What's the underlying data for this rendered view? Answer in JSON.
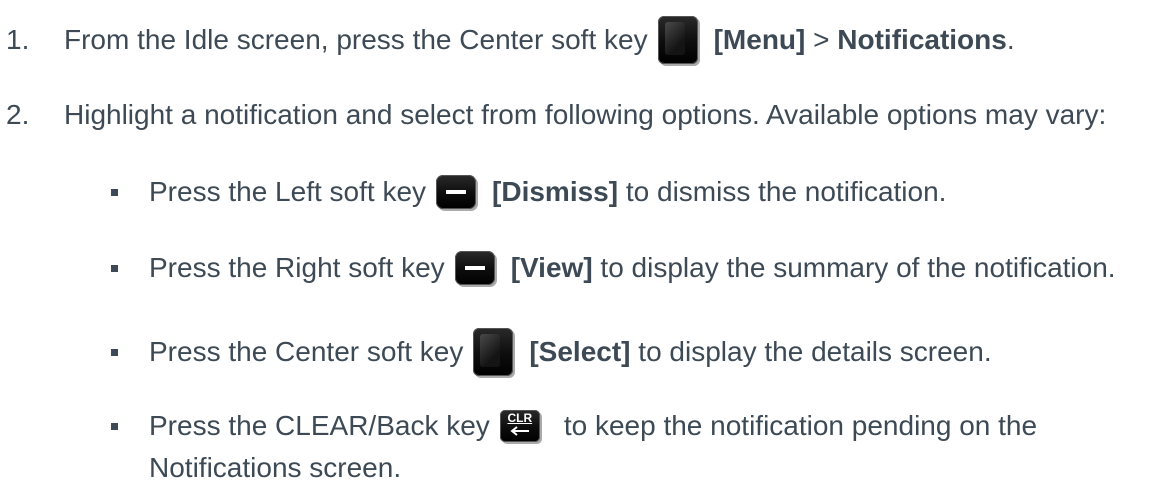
{
  "step1": {
    "number": "1.",
    "text_before": "From the Idle screen, press the Center soft key",
    "menu_label": "[Menu]",
    "separator": ">",
    "notifications_label": "Notifications",
    "period": "."
  },
  "step2": {
    "number": "2.",
    "text": "Highlight a notification and select from following options. Available options may vary:"
  },
  "options": {
    "dismiss": {
      "text_before": "Press the Left soft key",
      "label": "[Dismiss]",
      "text_after": "to dismiss the notification."
    },
    "view": {
      "text_before": "Press the Right soft key",
      "label": "[View]",
      "text_after": "to display the summary of the notification."
    },
    "select": {
      "text_before": "Press the Center soft key",
      "label": "[Select]",
      "text_after": "to display the details screen."
    },
    "clear": {
      "text_before": "Press the CLEAR/Back key",
      "key_text": "CLR",
      "text_after_line1": "to keep the notification pending on the",
      "text_after_line2": "Notifications screen."
    }
  },
  "icons": {
    "center_key": "center-soft-key-icon",
    "left_key": "left-soft-key-icon",
    "right_key": "right-soft-key-icon",
    "clr_key": "clr-back-key-icon"
  }
}
